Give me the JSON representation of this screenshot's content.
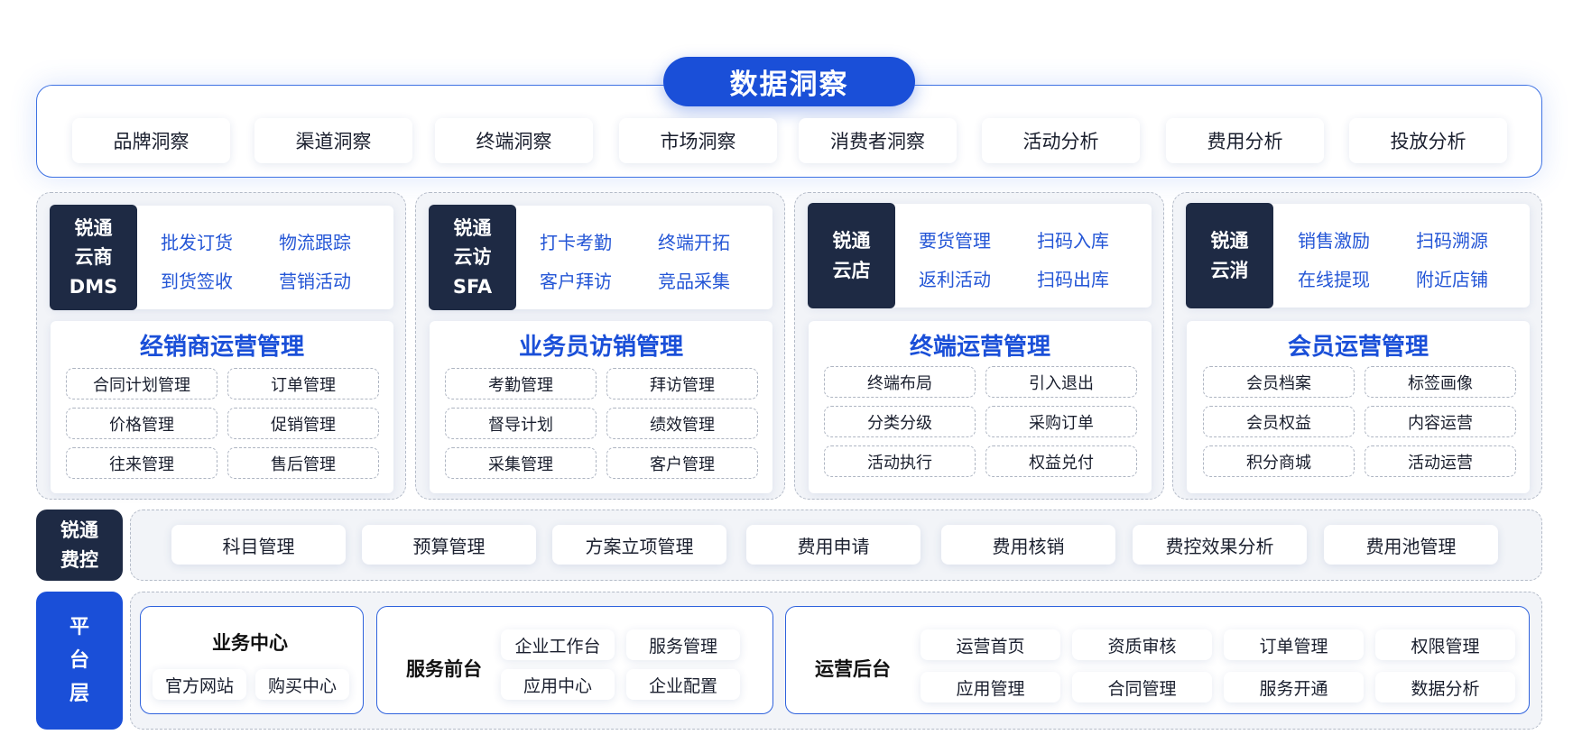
{
  "data_insight": {
    "title": "数据洞察",
    "items": [
      "品牌洞察",
      "渠道洞察",
      "终端洞察",
      "市场洞察",
      "消费者洞察",
      "活动分析",
      "费用分析",
      "投放分析"
    ]
  },
  "modules": [
    {
      "badge": [
        "锐通",
        "云商",
        "DMS"
      ],
      "features": [
        "批发订货",
        "物流跟踪",
        "到货签收",
        "营销活动"
      ],
      "title": "经销商运营管理",
      "items": [
        "合同计划管理",
        "订单管理",
        "价格管理",
        "促销管理",
        "往来管理",
        "售后管理"
      ]
    },
    {
      "badge": [
        "锐通",
        "云访",
        "SFA"
      ],
      "features": [
        "打卡考勤",
        "终端开拓",
        "客户拜访",
        "竞品采集"
      ],
      "title": "业务员访销管理",
      "items": [
        "考勤管理",
        "拜访管理",
        "督导计划",
        "绩效管理",
        "采集管理",
        "客户管理"
      ]
    },
    {
      "badge": [
        "锐通",
        "云店"
      ],
      "features": [
        "要货管理",
        "扫码入库",
        "返利活动",
        "扫码出库"
      ],
      "title": "终端运营管理",
      "items": [
        "终端布局",
        "引入退出",
        "分类分级",
        "采购订单",
        "活动执行",
        "权益兑付"
      ]
    },
    {
      "badge": [
        "锐通",
        "云消"
      ],
      "features": [
        "销售激励",
        "扫码溯源",
        "在线提现",
        "附近店铺"
      ],
      "title": "会员运营管理",
      "items": [
        "会员档案",
        "标签画像",
        "会员权益",
        "内容运营",
        "积分商城",
        "活动运营"
      ]
    }
  ],
  "expense_control": {
    "badge": [
      "锐通",
      "费控"
    ],
    "items": [
      "科目管理",
      "预算管理",
      "方案立项管理",
      "费用申请",
      "费用核销",
      "费控效果分析",
      "费用池管理"
    ]
  },
  "platform": {
    "badge": [
      "平",
      "台",
      "层"
    ],
    "business_center": {
      "title": "业务中心",
      "items": [
        "官方网站",
        "购买中心"
      ]
    },
    "service_front": {
      "title": "服务前台",
      "items": [
        "企业工作台",
        "服务管理",
        "应用中心",
        "企业配置"
      ]
    },
    "ops_backend": {
      "title": "运营后台",
      "items": [
        "运营首页",
        "资质审核",
        "订单管理",
        "权限管理",
        "应用管理",
        "合同管理",
        "服务开通",
        "数据分析"
      ]
    }
  },
  "colors": {
    "accent_blue": "#1a4fd8",
    "badge_navy": "#1e2a44",
    "feature_blue": "#2456d6",
    "panel_bg": "#f2f4f8"
  }
}
